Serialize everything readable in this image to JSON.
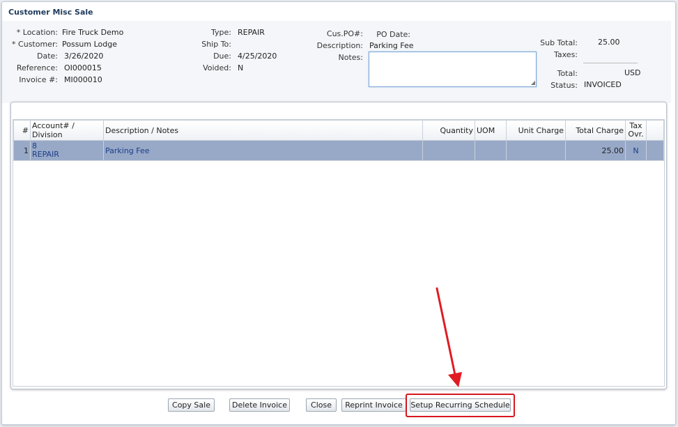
{
  "title": "Customer Misc Sale",
  "header": {
    "col1": [
      {
        "label": "* Location:",
        "value": "Fire Truck Demo"
      },
      {
        "label": "* Customer:",
        "value": "Possum Lodge"
      },
      {
        "label": "Date:",
        "value": "3/26/2020"
      },
      {
        "label": "Reference:",
        "value": "OI000015"
      },
      {
        "label": "Invoice #:",
        "value": "MI000010"
      }
    ],
    "col2": [
      {
        "label": "Type:",
        "value": "REPAIR"
      },
      {
        "label": "Ship To:",
        "value": ""
      },
      {
        "label": "Due:",
        "value": "4/25/2020"
      },
      {
        "label": "Voided:",
        "value": "N"
      }
    ],
    "cus_po_label": "Cus.PO#:",
    "po_date_label": "PO Date:",
    "description_label": "Description:",
    "description_value": "Parking Fee",
    "notes_label": "Notes:",
    "notes_value": "",
    "subtotal_label": "Sub Total:",
    "subtotal_value": "25.00",
    "taxes_label": "Taxes:",
    "total_label": "Total:",
    "total_currency": "USD",
    "status_label": "Status:",
    "status_value": "INVOICED"
  },
  "table": {
    "columns": [
      "#",
      "Account# / Division",
      "Description / Notes",
      "Quantity",
      "UOM",
      "Unit Charge",
      "Total Charge",
      "Tax Ovr."
    ],
    "rows": [
      {
        "num": "1",
        "account": "8",
        "division": "REPAIR",
        "description": "Parking Fee",
        "quantity": "",
        "uom": "",
        "unit_charge": "",
        "total_charge": "25.00",
        "tax_ovr": "N"
      }
    ]
  },
  "buttons": {
    "copy_sale": "Copy Sale",
    "delete_invoice": "Delete Invoice",
    "close": "Close",
    "reprint_invoice": "Reprint Invoice",
    "setup_recurring": "Setup Recurring Schedule"
  },
  "colors": {
    "highlight": "#d6161c",
    "selected_row": "#98a9c8",
    "row_text": "#1b3e86"
  }
}
